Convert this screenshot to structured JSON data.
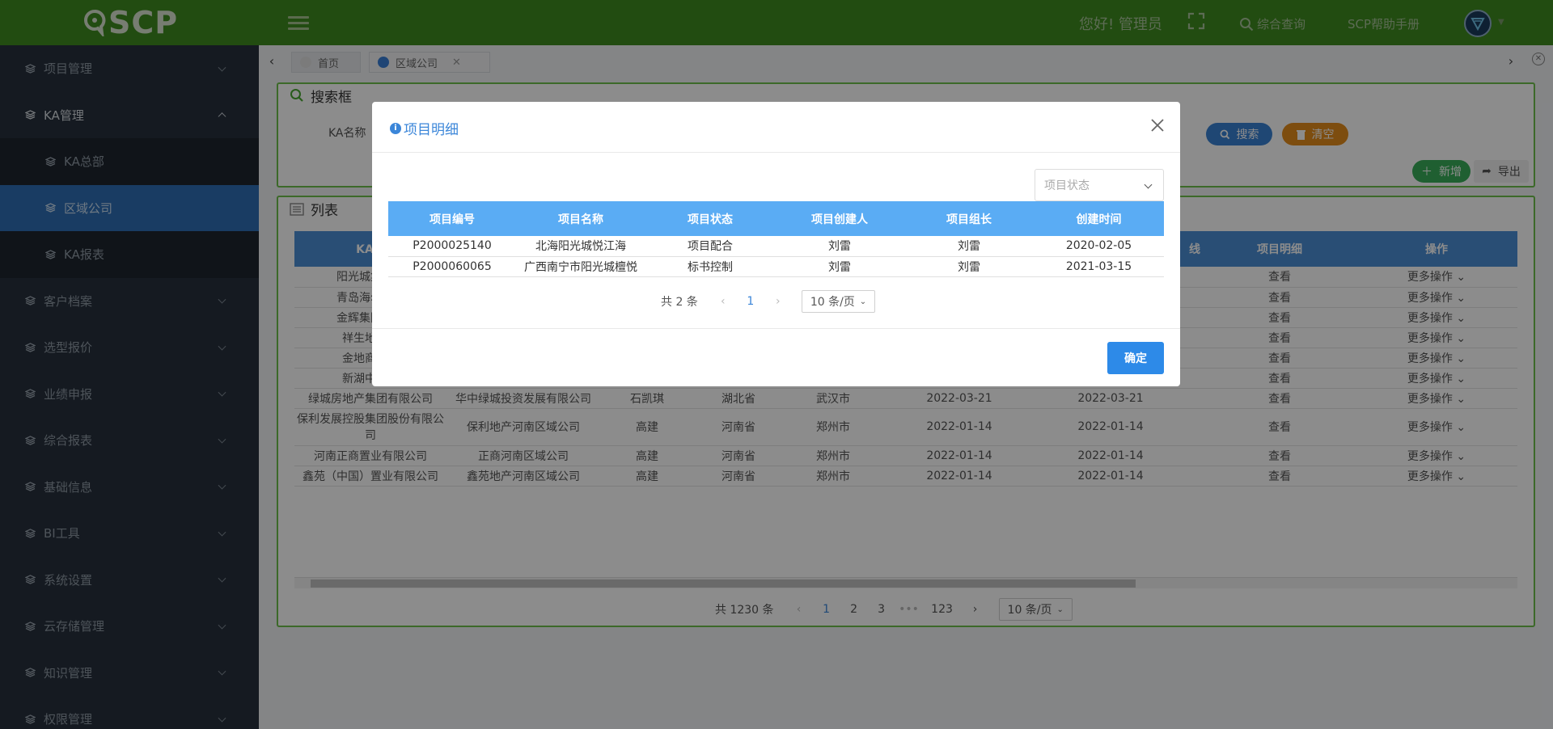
{
  "header": {
    "logo_text": "SCP",
    "greeting": "您好! 管理员",
    "search_link": "综合查询",
    "help_link": "SCP帮助手册"
  },
  "sidebar": {
    "items": [
      {
        "label": "项目管理"
      },
      {
        "label": "KA管理"
      },
      {
        "label": "客户档案"
      },
      {
        "label": "选型报价"
      },
      {
        "label": "业绩申报"
      },
      {
        "label": "综合报表"
      },
      {
        "label": "基础信息"
      },
      {
        "label": "BI工具"
      },
      {
        "label": "系统设置"
      },
      {
        "label": "云存储管理"
      },
      {
        "label": "知识管理"
      },
      {
        "label": "权限管理"
      }
    ],
    "ka_sub": [
      {
        "label": "KA总部"
      },
      {
        "label": "区域公司"
      },
      {
        "label": "KA报表"
      }
    ]
  },
  "tabs": [
    {
      "label": "首页"
    },
    {
      "label": "区域公司"
    }
  ],
  "search_panel": {
    "title": "搜索框",
    "ka_name_label": "KA名称",
    "search_btn": "搜索",
    "clear_btn": "清空",
    "add_btn": "新增",
    "export_btn": "导出"
  },
  "list_panel": {
    "title": "列表",
    "columns": [
      "KA总",
      "",
      "",
      "",
      "",
      "",
      "",
      "线",
      "项目明细",
      "操作"
    ],
    "rows": [
      {
        "ka": "阳光城集团股",
        "region": "",
        "leader": "",
        "prov": "",
        "city": "",
        "d1": "",
        "d2": "",
        "view": "查看",
        "more": "更多操作"
      },
      {
        "ka": "青岛海尔地产",
        "region": "",
        "leader": "",
        "prov": "",
        "city": "",
        "d1": "",
        "d2": "",
        "view": "查看",
        "more": "更多操作"
      },
      {
        "ka": "金辉集团股份",
        "region": "",
        "leader": "",
        "prov": "",
        "city": "",
        "d1": "",
        "d2": "",
        "view": "查看",
        "more": "更多操作"
      },
      {
        "ka": "祥生地产集",
        "region": "",
        "leader": "",
        "prov": "",
        "city": "",
        "d1": "",
        "d2": "",
        "view": "查看",
        "more": "更多操作"
      },
      {
        "ka": "金地商置集",
        "region": "",
        "leader": "",
        "prov": "",
        "city": "",
        "d1": "",
        "d2": "",
        "view": "查看",
        "more": "更多操作"
      },
      {
        "ka": "新湖中宝股",
        "region": "",
        "leader": "",
        "prov": "",
        "city": "",
        "d1": "",
        "d2": "",
        "view": "查看",
        "more": "更多操作"
      },
      {
        "ka": "绿城房地产集团有限公司",
        "region": "华中绿城投资发展有限公司",
        "leader": "石凯琪",
        "prov": "湖北省",
        "city": "武汉市",
        "d1": "2022-03-21",
        "d2": "2022-03-21",
        "view": "查看",
        "more": "更多操作"
      },
      {
        "ka": "保利发展控股集团股份有限公司",
        "region": "保利地产河南区域公司",
        "leader": "高建",
        "prov": "河南省",
        "city": "郑州市",
        "d1": "2022-01-14",
        "d2": "2022-01-14",
        "view": "查看",
        "more": "更多操作"
      },
      {
        "ka": "河南正商置业有限公司",
        "region": "正商河南区域公司",
        "leader": "高建",
        "prov": "河南省",
        "city": "郑州市",
        "d1": "2022-01-14",
        "d2": "2022-01-14",
        "view": "查看",
        "more": "更多操作"
      },
      {
        "ka": "鑫苑（中国）置业有限公司",
        "region": "鑫苑地产河南区域公司",
        "leader": "高建",
        "prov": "河南省",
        "city": "郑州市",
        "d1": "2022-01-14",
        "d2": "2022-01-14",
        "view": "查看",
        "more": "更多操作"
      }
    ],
    "pager": {
      "total": "共 1230 条",
      "pages": [
        "1",
        "2",
        "3",
        "•••",
        "123"
      ],
      "size": "10 条/页"
    }
  },
  "modal": {
    "title": "项目明细",
    "status_placeholder": "项目状态",
    "columns": [
      "项目编号",
      "项目名称",
      "项目状态",
      "项目创建人",
      "项目组长",
      "创建时间"
    ],
    "rows": [
      {
        "code": "P2000025140",
        "name": "北海阳光城悦江海",
        "status": "项目配合",
        "creator": "刘雷",
        "leader": "刘雷",
        "date": "2020-02-05"
      },
      {
        "code": "P2000060065",
        "name": "广西南宁市阳光城檀悦",
        "status": "标书控制",
        "creator": "刘雷",
        "leader": "刘雷",
        "date": "2021-03-15"
      }
    ],
    "pager": {
      "total": "共 2 条",
      "page": "1",
      "size": "10 条/页"
    },
    "ok_btn": "确定"
  },
  "colors": {
    "header_green": "#3f8a1f",
    "panel_border": "#6dbf4b",
    "sidebar_bg": "#27303c",
    "active_blue": "#2f6db4",
    "modal_header_blue": "#5aacf4",
    "primary_btn": "#2d8ae8"
  },
  "icons": {
    "menu": "layers-icon",
    "fullscreen": "fullscreen-icon",
    "search": "search-icon",
    "close": "close-icon"
  }
}
